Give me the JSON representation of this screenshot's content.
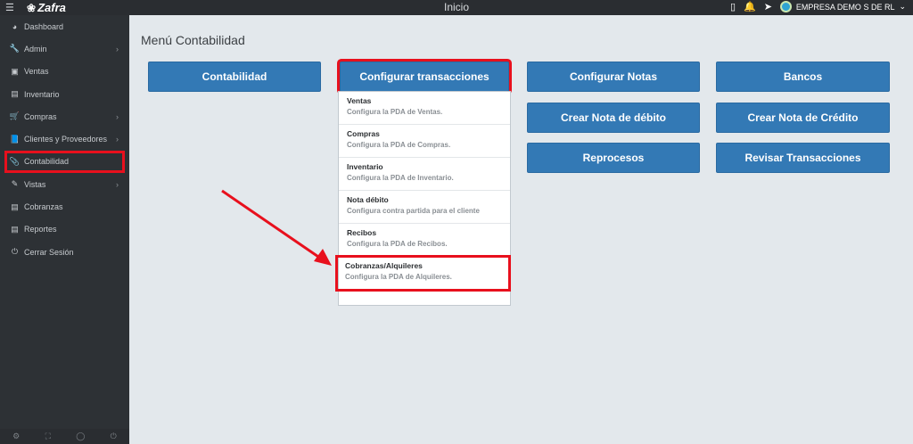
{
  "topbar": {
    "brand": "Zafra",
    "title": "Inicio",
    "company": "EMPRESA DEMO S DE RL",
    "icons": [
      "menu-icon",
      "mobile-icon",
      "bell-icon",
      "send-icon"
    ]
  },
  "sidebar": {
    "items": [
      {
        "label": "Dashboard",
        "icon": "dashboard-icon",
        "chevron": false
      },
      {
        "label": "Admin",
        "icon": "wrench-icon",
        "chevron": true
      },
      {
        "label": "Ventas",
        "icon": "money-icon",
        "chevron": false
      },
      {
        "label": "Inventario",
        "icon": "bars-icon",
        "chevron": false
      },
      {
        "label": "Compras",
        "icon": "cart-icon",
        "chevron": true
      },
      {
        "label": "Clientes y Proveedores",
        "icon": "book-icon",
        "chevron": true
      },
      {
        "label": "Contabilidad",
        "icon": "paperclip-icon",
        "chevron": false,
        "highlighted": true
      },
      {
        "label": "Vistas",
        "icon": "edit-icon",
        "chevron": true
      },
      {
        "label": "Cobranzas",
        "icon": "list-icon",
        "chevron": false
      },
      {
        "label": "Reportes",
        "icon": "list-icon",
        "chevron": false
      },
      {
        "label": "Cerrar Sesión",
        "icon": "power-icon",
        "chevron": false
      }
    ]
  },
  "main": {
    "heading": "Menú Contabilidad",
    "buttons": {
      "contabilidad": "Contabilidad",
      "configurar_transacciones": "Configurar transacciones",
      "configurar_notas": "Configurar Notas",
      "bancos": "Bancos",
      "crear_nota_debito": "Crear Nota de débito",
      "crear_nota_credito": "Crear Nota de Crédito",
      "reprocesos": "Reprocesos",
      "revisar_transacciones": "Revisar Transacciones"
    },
    "dropdown": [
      {
        "title": "Ventas",
        "subtitle": "Configura la PDA de Ventas."
      },
      {
        "title": "Compras",
        "subtitle": "Configura la PDA de Compras."
      },
      {
        "title": "Inventario",
        "subtitle": "Configura la PDA de Inventario."
      },
      {
        "title": "Nota débito",
        "subtitle": "Configura contra partida para el cliente"
      },
      {
        "title": "Recibos",
        "subtitle": "Configura la PDA de Recibos."
      },
      {
        "title": "Cobranzas/Alquileres",
        "subtitle": "Configura la PDA de Alquileres.",
        "highlighted": true
      }
    ]
  },
  "colors": {
    "primary_button": "#3379b5",
    "annotation_red": "#e8101d",
    "sidebar_bg": "#2d3135",
    "page_bg": "#e3e8ec"
  }
}
